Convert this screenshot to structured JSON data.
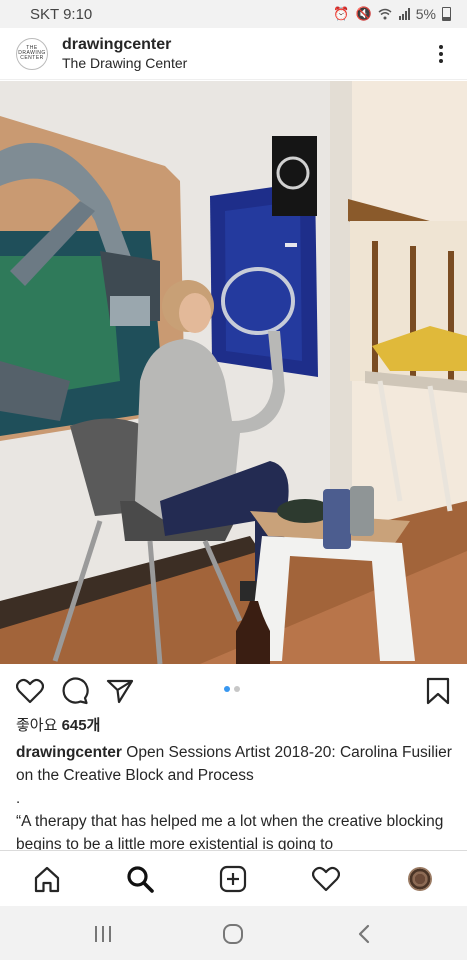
{
  "status_bar": {
    "carrier_time": "SKT 9:10",
    "battery": "5%",
    "icons": [
      "alarm-icon",
      "mute-icon",
      "wifi-icon",
      "signal-icon",
      "battery-icon"
    ]
  },
  "post": {
    "avatar_text": [
      "THE",
      "DRAWING",
      "CENTER"
    ],
    "username": "drawingcenter",
    "location": "The Drawing Center",
    "carousel": {
      "count": 2,
      "active": 0
    },
    "likes_prefix": "좋아요 ",
    "likes_count": "645개",
    "caption_user": "drawingcenter",
    "caption_text": "Open Sessions Artist 2018-20: Carolina Fusilier on the Creative Block and Process",
    "caption_dot": ".",
    "quote": "“A therapy that has helped me a lot when the creative blocking begins to be a little more existential is going to"
  },
  "colors": {
    "accent": "#3897f0",
    "text": "#262626"
  },
  "bottom_nav": [
    "home-icon",
    "search-icon",
    "new-post-icon",
    "activity-heart-icon",
    "profile-avatar"
  ],
  "system_nav": [
    "recent-apps-icon",
    "home-circle-icon",
    "back-icon"
  ]
}
